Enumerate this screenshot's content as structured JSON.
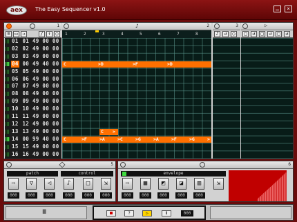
{
  "window": {
    "logo": "aex",
    "title": "The Easy Sequencer v1.0"
  },
  "header_numbers": {
    "tracks": "1",
    "grid": "2",
    "right_a": "3",
    "patch_panel": "5",
    "envelope_panel": "6"
  },
  "ruler": {
    "ticks": [
      "1",
      "2",
      "3",
      "4",
      "5",
      "6",
      "7",
      "8"
    ]
  },
  "tracks": [
    {
      "num": "01",
      "v1": "01",
      "v2": "49",
      "v3": "00",
      "v4": "00"
    },
    {
      "num": "02",
      "v1": "02",
      "v2": "49",
      "v3": "00",
      "v4": "00"
    },
    {
      "num": "03",
      "v1": "03",
      "v2": "49",
      "v3": "00",
      "v4": "00"
    },
    {
      "num": "04",
      "v1": "00",
      "v2": "49",
      "v3": "40",
      "v4": "00"
    },
    {
      "num": "05",
      "v1": "05",
      "v2": "49",
      "v3": "00",
      "v4": "00"
    },
    {
      "num": "06",
      "v1": "06",
      "v2": "49",
      "v3": "00",
      "v4": "00"
    },
    {
      "num": "07",
      "v1": "07",
      "v2": "49",
      "v3": "00",
      "v4": "00"
    },
    {
      "num": "08",
      "v1": "08",
      "v2": "49",
      "v3": "00",
      "v4": "00"
    },
    {
      "num": "09",
      "v1": "09",
      "v2": "49",
      "v3": "00",
      "v4": "00"
    },
    {
      "num": "10",
      "v1": "10",
      "v2": "49",
      "v3": "00",
      "v4": "00"
    },
    {
      "num": "11",
      "v1": "11",
      "v2": "49",
      "v3": "00",
      "v4": "00"
    },
    {
      "num": "12",
      "v1": "12",
      "v2": "49",
      "v3": "00",
      "v4": "00"
    },
    {
      "num": "13",
      "v1": "13",
      "v2": "49",
      "v3": "00",
      "v4": "00"
    },
    {
      "num": "14",
      "v1": "00",
      "v2": "99",
      "v3": "40",
      "v4": "00"
    },
    {
      "num": "15",
      "v1": "15",
      "v2": "49",
      "v3": "00",
      "v4": "00"
    },
    {
      "num": "16",
      "v1": "16",
      "v2": "49",
      "v3": "00",
      "v4": "00"
    }
  ],
  "notes": [
    {
      "row": 3,
      "labels": [
        "C",
        ">D",
        ">F",
        ">D"
      ]
    },
    {
      "row": 12,
      "labels": [
        "C",
        ">"
      ]
    },
    {
      "row": 13,
      "labels": [
        "C",
        ">F",
        ">A",
        ">C",
        ">G",
        ">A",
        ">F",
        ">G",
        ">"
      ]
    }
  ],
  "sections": {
    "patch": "patch",
    "control": "control",
    "envelope": "envelope"
  },
  "values": {
    "patch": [
      "000",
      "000",
      "000"
    ],
    "control": [
      "000",
      "000",
      "000"
    ],
    "envelope": [
      "000",
      "000",
      "000",
      "000",
      "000"
    ]
  },
  "transport": {
    "counter": "000"
  },
  "colors": {
    "accent": "#ff7000",
    "frame": "#6a0b0b",
    "grid": "#081c18",
    "envelope": "#c00000"
  }
}
